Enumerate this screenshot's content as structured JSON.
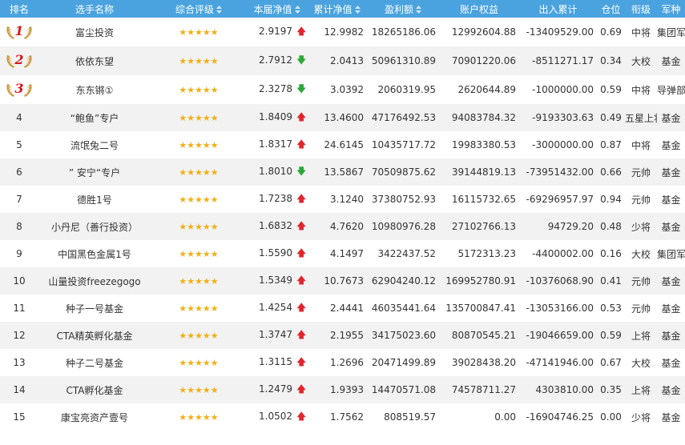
{
  "headers": {
    "rank": "排名",
    "name": "选手名称",
    "rating": "综合评级",
    "nav": "本届净值",
    "cum_nav": "累计净值",
    "profit": "盈利额",
    "equity": "账户权益",
    "flow": "出入累计",
    "position": "仓位",
    "rank_title": "衔级",
    "branch": "军种"
  },
  "colors": {
    "header_bg": "#4aa3df",
    "up": "#e3242b",
    "down": "#2aa837",
    "star": "#f2b011",
    "medal": "#d4181c"
  },
  "icons": {
    "up": "arrow-up-icon",
    "down": "arrow-down-icon",
    "star": "star-icon",
    "sort": "sort-icon",
    "medal": "laurel-medal-icon"
  },
  "rows": [
    {
      "rank": "1",
      "name": "富尘投资",
      "stars": "★★★★★",
      "nav": "2.9197",
      "trend": "up",
      "cum": "12.9982",
      "profit": "18265186.06",
      "equity": "12992604.88",
      "flow": "-13409529.00",
      "position": "0.69",
      "title": "中将",
      "branch": "集团军"
    },
    {
      "rank": "2",
      "name": "依依东望",
      "stars": "★★★★★",
      "nav": "2.7912",
      "trend": "down",
      "cum": "2.0413",
      "profit": "50961310.89",
      "equity": "70901220.06",
      "flow": "-8511271.17",
      "position": "0.34",
      "title": "大校",
      "branch": "基金"
    },
    {
      "rank": "3",
      "name": "东东锵①",
      "stars": "★★★★★",
      "nav": "2.3278",
      "trend": "down",
      "cum": "3.0392",
      "profit": "2060319.95",
      "equity": "2620644.89",
      "flow": "-1000000.00",
      "position": "0.59",
      "title": "中将",
      "branch": "导弹部队"
    },
    {
      "rank": "4",
      "name": "“鲍鱼”专户",
      "stars": "★★★★★",
      "nav": "1.8409",
      "trend": "up",
      "cum": "13.4600",
      "profit": "47176492.53",
      "equity": "94083784.32",
      "flow": "-9193303.63",
      "position": "0.49",
      "title": "五星上将",
      "branch": "基金"
    },
    {
      "rank": "5",
      "name": "流氓兔二号",
      "stars": "★★★★★",
      "nav": "1.8317",
      "trend": "up",
      "cum": "24.6145",
      "profit": "10435717.72",
      "equity": "19983380.53",
      "flow": "-3000000.00",
      "position": "0.87",
      "title": "中将",
      "branch": "基金"
    },
    {
      "rank": "6",
      "name": "” 安宁“专户",
      "stars": "★★★★★",
      "nav": "1.8010",
      "trend": "down",
      "cum": "13.5867",
      "profit": "70509875.62",
      "equity": "39144819.13",
      "flow": "-73951432.00",
      "position": "0.66",
      "title": "元帅",
      "branch": "基金"
    },
    {
      "rank": "7",
      "name": "德胜1号",
      "stars": "★★★★★",
      "nav": "1.7238",
      "trend": "up",
      "cum": "3.1240",
      "profit": "37380752.93",
      "equity": "16115732.65",
      "flow": "-69296957.97",
      "position": "0.94",
      "title": "元帅",
      "branch": "基金"
    },
    {
      "rank": "8",
      "name": "小丹尼（善行投资）",
      "stars": "★★★★★",
      "nav": "1.6832",
      "trend": "up",
      "cum": "4.7620",
      "profit": "10980976.28",
      "equity": "27102766.13",
      "flow": "94729.20",
      "position": "0.48",
      "title": "少将",
      "branch": "基金"
    },
    {
      "rank": "9",
      "name": "中国黑色金属1号",
      "stars": "★★★★★",
      "nav": "1.5590",
      "trend": "up",
      "cum": "4.1497",
      "profit": "3422437.52",
      "equity": "5172313.23",
      "flow": "-4400002.00",
      "position": "0.16",
      "title": "大校",
      "branch": "集团军"
    },
    {
      "rank": "10",
      "name": "山量投资freezegogo",
      "stars": "★★★★★",
      "nav": "1.5349",
      "trend": "up",
      "cum": "10.7673",
      "profit": "62904240.12",
      "equity": "169952780.91",
      "flow": "-10376068.90",
      "position": "0.41",
      "title": "元帅",
      "branch": "基金"
    },
    {
      "rank": "11",
      "name": "种子一号基金",
      "stars": "★★★★★",
      "nav": "1.4254",
      "trend": "up",
      "cum": "2.4441",
      "profit": "46035441.64",
      "equity": "135700847.41",
      "flow": "-13053166.00",
      "position": "0.53",
      "title": "元帅",
      "branch": "基金"
    },
    {
      "rank": "12",
      "name": "CTA精英孵化基金",
      "stars": "★★★★★",
      "nav": "1.3747",
      "trend": "up",
      "cum": "2.1955",
      "profit": "34175023.60",
      "equity": "80870545.21",
      "flow": "-19046659.00",
      "position": "0.59",
      "title": "上将",
      "branch": "基金"
    },
    {
      "rank": "13",
      "name": "种子二号基金",
      "stars": "★★★★★",
      "nav": "1.3115",
      "trend": "up",
      "cum": "1.2696",
      "profit": "20471499.89",
      "equity": "39028438.20",
      "flow": "-47141946.00",
      "position": "0.67",
      "title": "大校",
      "branch": "基金"
    },
    {
      "rank": "14",
      "name": "CTA孵化基金",
      "stars": "★★★★★",
      "nav": "1.2479",
      "trend": "up",
      "cum": "1.9393",
      "profit": "14470571.08",
      "equity": "74578711.27",
      "flow": "4303810.00",
      "position": "0.35",
      "title": "上将",
      "branch": "基金"
    },
    {
      "rank": "15",
      "name": "康宝亮资产壹号",
      "stars": "★★★★★",
      "nav": "1.0502",
      "trend": "up",
      "cum": "1.7562",
      "profit": "808519.57",
      "equity": "0.00",
      "flow": "-16904746.25",
      "position": "0.00",
      "title": "少将",
      "branch": "基金"
    }
  ]
}
